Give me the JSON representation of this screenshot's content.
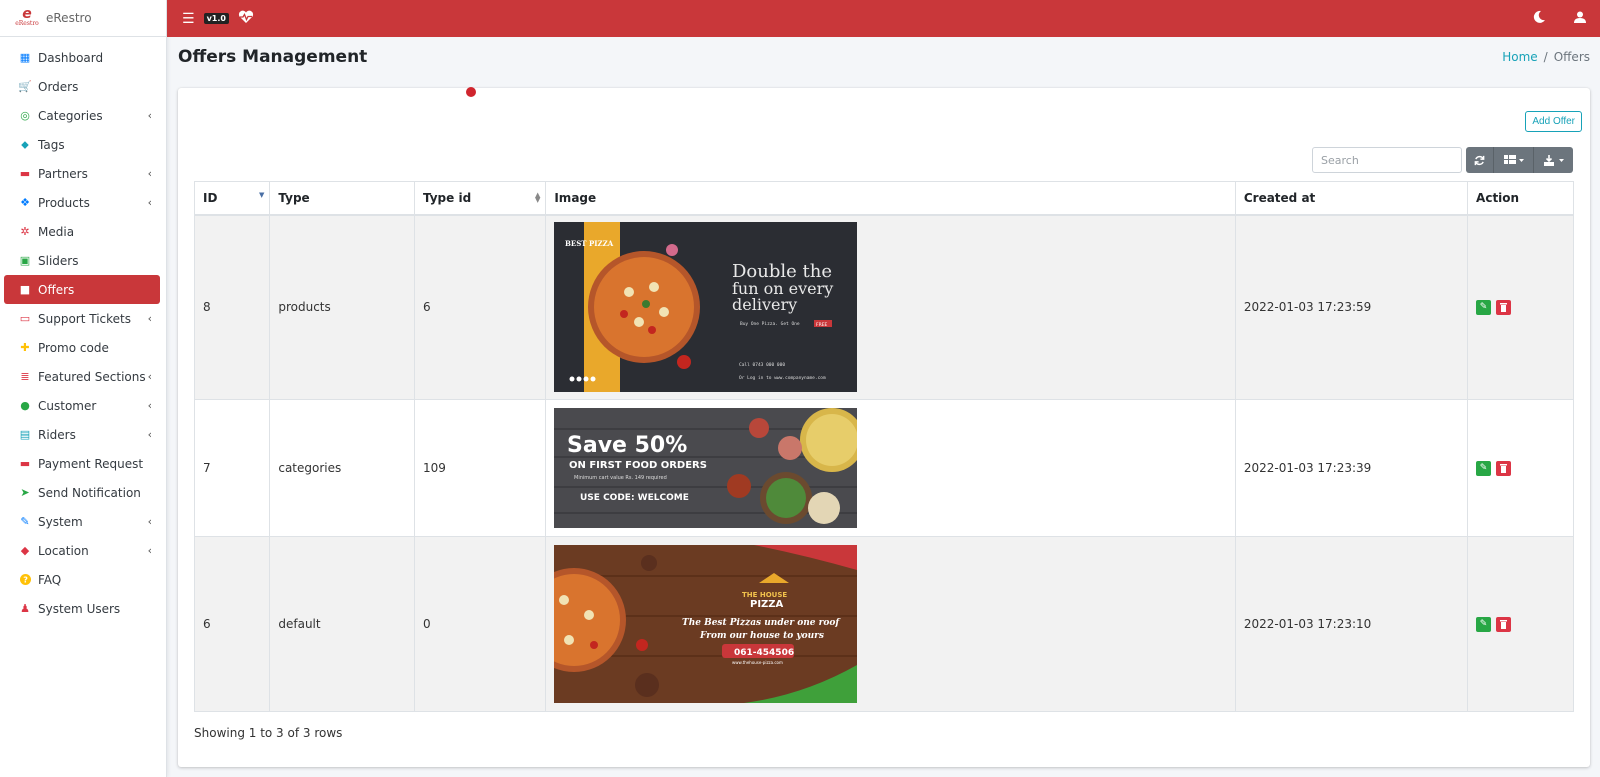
{
  "brand": {
    "name": "eRestro",
    "logo_text": "eRestro"
  },
  "topbar": {
    "version": "v1.0"
  },
  "sidebar": {
    "items": [
      {
        "label": "Dashboard",
        "icon": "dashboard-icon",
        "color": "#007bff",
        "chev": false
      },
      {
        "label": "Orders",
        "icon": "cart-icon",
        "color": "#ffc107",
        "chev": false
      },
      {
        "label": "Categories",
        "icon": "bullseye-icon",
        "color": "#28a745",
        "chev": true
      },
      {
        "label": "Tags",
        "icon": "tag-icon",
        "color": "#17a2b8",
        "chev": false
      },
      {
        "label": "Partners",
        "icon": "store-icon",
        "color": "#dc3545",
        "chev": true
      },
      {
        "label": "Products",
        "icon": "cubes-icon",
        "color": "#007bff",
        "chev": true
      },
      {
        "label": "Media",
        "icon": "media-icon",
        "color": "#dc3545",
        "chev": false
      },
      {
        "label": "Sliders",
        "icon": "image-icon",
        "color": "#28a745",
        "chev": false
      },
      {
        "label": "Offers",
        "icon": "gift-icon",
        "color": "#ffffff",
        "chev": false,
        "active": true
      },
      {
        "label": "Support Tickets",
        "icon": "ticket-icon",
        "color": "#dc3545",
        "chev": true
      },
      {
        "label": "Promo code",
        "icon": "puzzle-icon",
        "color": "#ffc107",
        "chev": false
      },
      {
        "label": "Featured Sections",
        "icon": "layers-icon",
        "color": "#dc3545",
        "chev": true
      },
      {
        "label": "Customer",
        "icon": "user-icon",
        "color": "#28a745",
        "chev": true
      },
      {
        "label": "Riders",
        "icon": "id-badge-icon",
        "color": "#17a2b8",
        "chev": true
      },
      {
        "label": "Payment Request",
        "icon": "money-icon",
        "color": "#dc3545",
        "chev": false
      },
      {
        "label": "Send Notification",
        "icon": "paper-plane-icon",
        "color": "#28a745",
        "chev": false
      },
      {
        "label": "System",
        "icon": "wrench-icon",
        "color": "#007bff",
        "chev": true
      },
      {
        "label": "Location",
        "icon": "map-icon",
        "color": "#dc3545",
        "chev": true
      },
      {
        "label": "FAQ",
        "icon": "question-icon",
        "color": "#ffc107",
        "chev": false
      },
      {
        "label": "System Users",
        "icon": "user-tie-icon",
        "color": "#dc3545",
        "chev": false
      }
    ]
  },
  "page": {
    "title": "Offers Management"
  },
  "breadcrumb": {
    "home": "Home",
    "separator": "/",
    "current": "Offers"
  },
  "toolbar": {
    "add_offer": "Add Offer",
    "search_placeholder": "Search"
  },
  "table": {
    "headers": {
      "id": "ID",
      "type": "Type",
      "type_id": "Type id",
      "image": "Image",
      "created_at": "Created at",
      "action": "Action"
    },
    "rows": [
      {
        "id": "8",
        "type": "products",
        "type_id": "6",
        "created_at": "2022-01-03 17:23:59",
        "banner": {
          "brand": "BEST PIZZA",
          "headline1": "Double the",
          "headline2": "fun on every",
          "headline3": "delivery",
          "sub": "Buy One Pizza. Get One",
          "badge": "FREE",
          "call": "Call 0743 000 000",
          "web": "Or Log in to www.companyname.com"
        }
      },
      {
        "id": "7",
        "type": "categories",
        "type_id": "109",
        "created_at": "2022-01-03 17:23:39",
        "banner": {
          "headline": "Save 50%",
          "sub": "ON FIRST FOOD ORDERS",
          "min": "Minimum cart value Rs. 149 required",
          "code": "USE CODE: WELCOME"
        }
      },
      {
        "id": "6",
        "type": "default",
        "type_id": "0",
        "created_at": "2022-01-03 17:23:10",
        "banner": {
          "brand1": "THE HOUSE",
          "brand2": "PIZZA",
          "line1": "The Best Pizzas under one roof",
          "line2": "From our house to yours",
          "phone": "061-454506",
          "web": "www.thehouse-pizza.com"
        }
      }
    ]
  },
  "footer": {
    "showing": "Showing 1 to 3 of 3 rows"
  }
}
